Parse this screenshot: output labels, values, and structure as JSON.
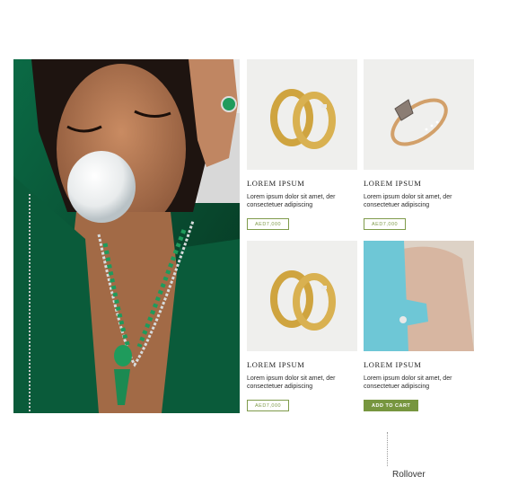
{
  "hero": {
    "image": "woman-emerald-necklace-bubblegum"
  },
  "products": [
    {
      "title": "LOREM IPSUM",
      "desc": "Lorem ipsum dolor sit amet, der consectetuer adipiscing",
      "price": "AED7,000",
      "image": "gold-wedding-bands-icon"
    },
    {
      "title": "LOREM IPSUM",
      "desc": "Lorem ipsum dolor sit amet, der consectetuer adipiscing",
      "price": "AED7,000",
      "image": "rose-gold-diamond-ring-icon"
    },
    {
      "title": "LOREM IPSUM",
      "desc": "Lorem ipsum dolor sit amet, der consectetuer adipiscing",
      "price": "AED7,000",
      "image": "gold-wedding-bands-icon"
    },
    {
      "title": "LOREM IPSUM",
      "desc": "Lorem ipsum dolor sit amet, der consectetuer adipiscing",
      "price": "ADD TO CART",
      "image": "model-blue-gloves-ring-icon"
    }
  ],
  "annotation": {
    "label": "Rollover"
  },
  "colors": {
    "accent": "#77963f",
    "thumb_bg": "#efefed",
    "emerald": "#0f5a3b"
  }
}
